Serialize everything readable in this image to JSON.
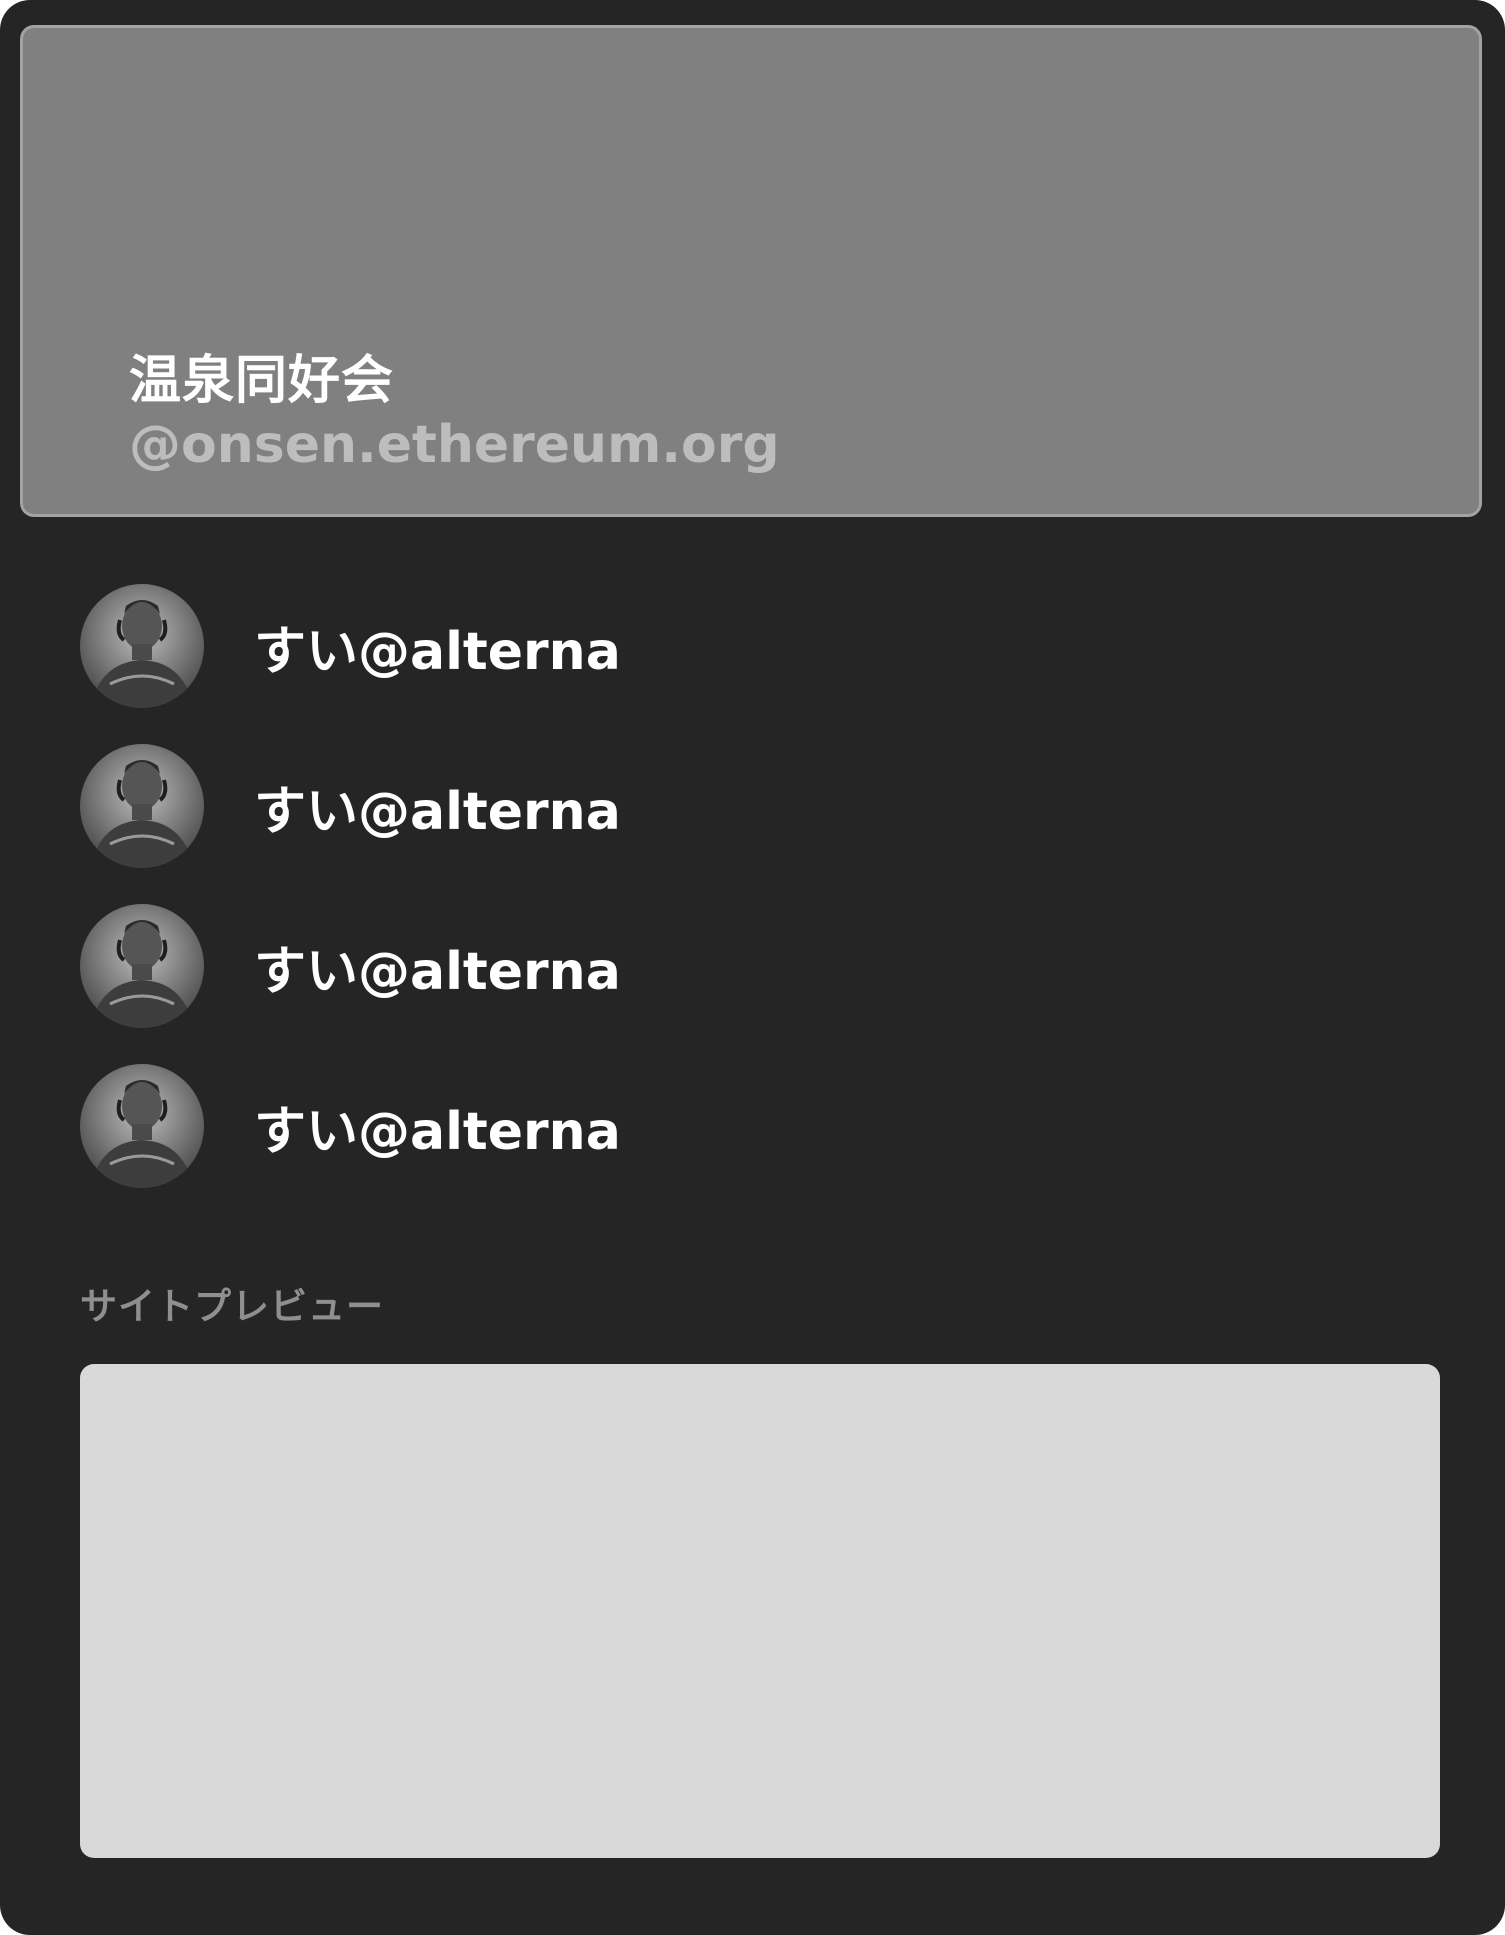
{
  "group": {
    "name": "温泉同好会",
    "handle": "@onsen.ethereum.org"
  },
  "members": [
    {
      "name": "すい@alterna",
      "avatar_icon": "statue-avatar-icon"
    },
    {
      "name": "すい@alterna",
      "avatar_icon": "statue-avatar-icon"
    },
    {
      "name": "すい@alterna",
      "avatar_icon": "statue-avatar-icon"
    },
    {
      "name": "すい@alterna",
      "avatar_icon": "statue-avatar-icon"
    }
  ],
  "preview": {
    "label": "サイトプレビュー"
  },
  "colors": {
    "panel_background": "#252525",
    "header_background": "#808080",
    "header_border": "#a3a3a3",
    "handle_text": "#bdbdbd",
    "preview_label_text": "#8f8f8f",
    "preview_background": "#d9d9d9"
  }
}
